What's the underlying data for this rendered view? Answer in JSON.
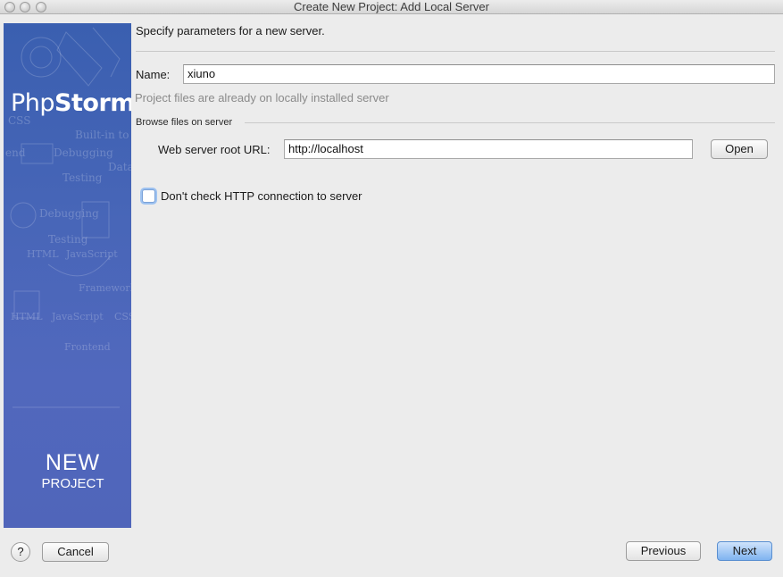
{
  "window": {
    "title": "Create New Project: Add Local Server"
  },
  "banner": {
    "logo_light": "Php",
    "logo_bold": "Storm",
    "new_label": "NEW",
    "project_label": "PROJECT",
    "ghost_words": [
      "CSS",
      "Built-in to",
      "end",
      "Debugging",
      "Data",
      "Testing",
      "Debugging",
      "Testing",
      "HTML",
      "JavaScript",
      "Framework",
      "HTML",
      "JavaScript",
      "CSS",
      "Frontend"
    ]
  },
  "form": {
    "heading": "Specify parameters for a new server.",
    "name_label": "Name:",
    "name_value": "xiuno",
    "hint": "Project files are already on locally installed server",
    "section_title": "Browse files on server",
    "url_label": "Web server root URL:",
    "url_value": "http://localhost",
    "open_button": "Open",
    "checkbox_label": "Don't check HTTP connection to server",
    "checkbox_checked": false
  },
  "footer": {
    "help_label": "?",
    "cancel": "Cancel",
    "previous": "Previous",
    "next": "Next"
  },
  "colors": {
    "banner": "#4866b8",
    "primary_button": "#7fb3f0"
  }
}
